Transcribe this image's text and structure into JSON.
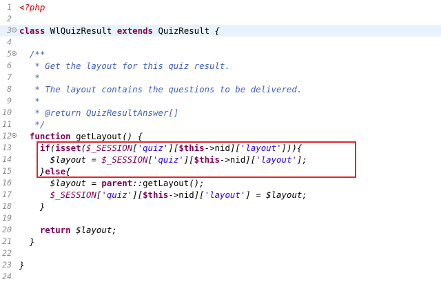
{
  "editor": {
    "highlight_color": "#e0252b",
    "lines": [
      {
        "n": "1",
        "text": "<?php"
      },
      {
        "n": "2",
        "text": ""
      },
      {
        "n": "3",
        "text": "class WlQuizResult extends QuizResult {"
      },
      {
        "n": "4",
        "text": ""
      },
      {
        "n": "5",
        "text": "  /**"
      },
      {
        "n": "6",
        "text": "   * Get the layout for this quiz result."
      },
      {
        "n": "7",
        "text": "   *"
      },
      {
        "n": "8",
        "text": "   * The layout contains the questions to be delivered."
      },
      {
        "n": "9",
        "text": "   *"
      },
      {
        "n": "10",
        "text": "   * @return QuizResultAnswer[]"
      },
      {
        "n": "11",
        "text": "   */"
      },
      {
        "n": "12",
        "text": "  function getLayout() {"
      },
      {
        "n": "13",
        "text": "    if(isset($_SESSION['quiz'][$this->nid]['layout'])){"
      },
      {
        "n": "14",
        "text": "      $layout = $_SESSION['quiz'][$this->nid]['layout'];"
      },
      {
        "n": "15",
        "text": "    }else{"
      },
      {
        "n": "16",
        "text": "      $layout = parent::getLayout();"
      },
      {
        "n": "17",
        "text": "      $_SESSION['quiz'][$this->nid]['layout'] = $layout;"
      },
      {
        "n": "18",
        "text": "    }"
      },
      {
        "n": "19",
        "text": ""
      },
      {
        "n": "20",
        "text": "    return $layout;"
      },
      {
        "n": "21",
        "text": "  }"
      },
      {
        "n": "22",
        "text": ""
      },
      {
        "n": "23",
        "text": "}"
      },
      {
        "n": "24",
        "text": ""
      }
    ]
  }
}
